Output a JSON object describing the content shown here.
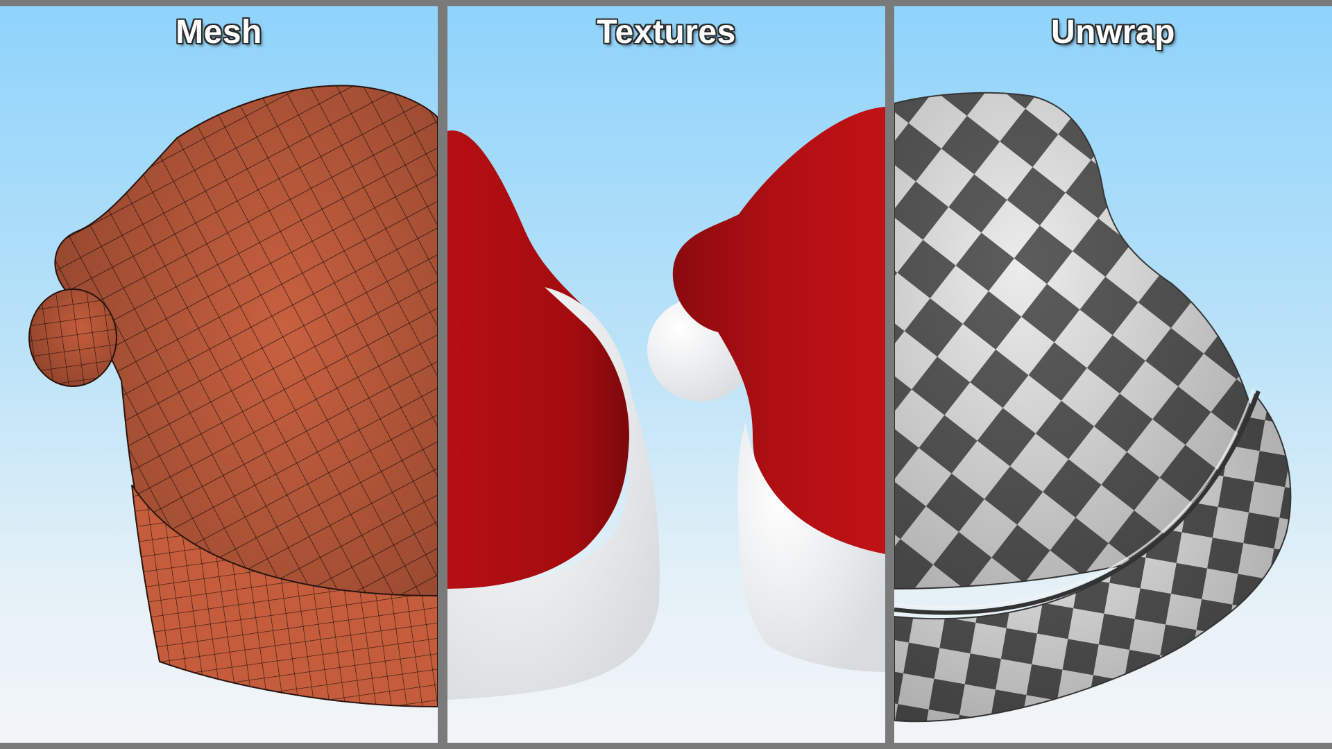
{
  "panels": [
    {
      "title": "Mesh"
    },
    {
      "title": "Textures"
    },
    {
      "title": "Unwrap"
    }
  ],
  "colors": {
    "frame": "#7a7a7a",
    "sky_top": "#8fd3fb",
    "sky_bottom": "#f2f5f8",
    "mesh_fill": "#c8603f",
    "hat_red": "#b50f13",
    "fur_white": "#f4f4f4",
    "checker_dark": "#5c5c5c",
    "checker_light": "#ececec"
  }
}
